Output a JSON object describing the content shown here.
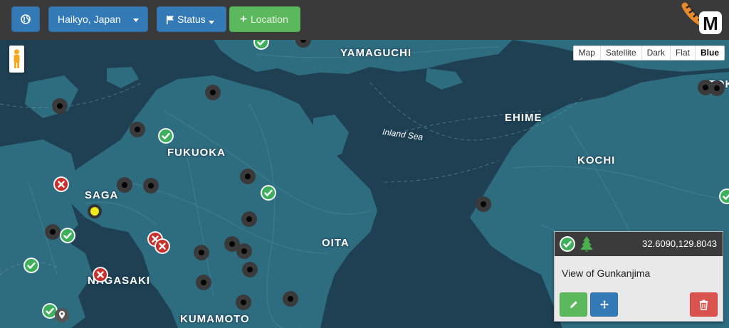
{
  "toolbar": {
    "globe_icon": "globe-icon",
    "location_select": "Haikyo, Japan",
    "status_label": "Status",
    "add_location_label": "Location",
    "colors": {
      "bar": "#3a3a3a",
      "primary": "#337ab7",
      "success": "#5cb85c"
    }
  },
  "map": {
    "type_controls": [
      "Map",
      "Satellite",
      "Dark",
      "Flat",
      "Blue"
    ],
    "active_type": "Blue",
    "labels": {
      "yamaguchi": "YAMAGUCHI",
      "ehime": "EHIME",
      "fukuoka": "FUKUOKA",
      "kochi": "KOCHI",
      "saga": "SAGA",
      "oita": "OITA",
      "nagasaki": "NAGASAKI",
      "kumamoto": "KUMAMOTO",
      "tok": "TOK",
      "inland_sea": "Inland Sea"
    },
    "colors": {
      "water": "#1f3f52",
      "land": "#2e6c80",
      "road": "#3d7f92"
    }
  },
  "panel": {
    "coords": "32.6090,129.8043",
    "title": "View of Gunkanjima",
    "status_icon": "check-circle-icon",
    "category_icon": "tree-icon",
    "colors": {
      "edit": "#5cb85c",
      "move": "#337ab7",
      "delete": "#d9534f"
    }
  }
}
